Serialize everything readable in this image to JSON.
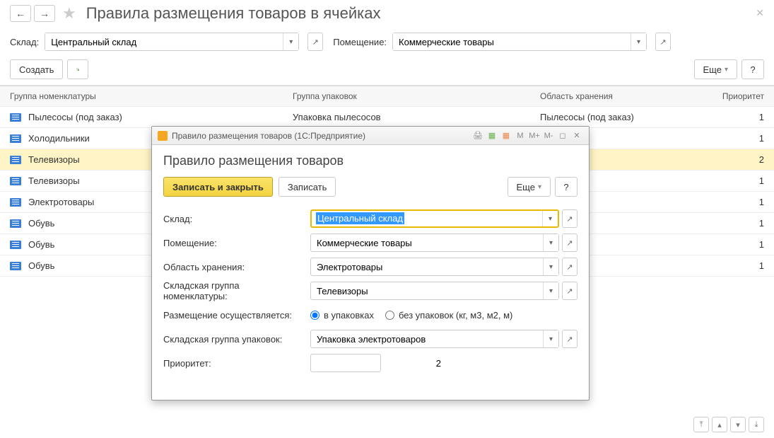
{
  "nav": {
    "back": "←",
    "forward": "→"
  },
  "page_title": "Правила размещения товаров в ячейках",
  "filters": {
    "warehouse_label": "Склад:",
    "warehouse_value": "Центральный склад",
    "room_label": "Помещение:",
    "room_value": "Коммерческие товары"
  },
  "toolbar": {
    "create": "Создать",
    "more": "Еще",
    "help": "?"
  },
  "columns": {
    "group": "Группа номенклатуры",
    "pack": "Группа упаковок",
    "area": "Область хранения",
    "priority": "Приоритет"
  },
  "rows": [
    {
      "group": "Пылесосы (под заказ)",
      "pack": "Упаковка пылесосов",
      "area": "Пылесосы (под заказ)",
      "priority": "1"
    },
    {
      "group": "Холодильники",
      "pack": "",
      "area": "",
      "priority": "1"
    },
    {
      "group": "Телевизоры",
      "pack": "",
      "area": "",
      "priority": "2",
      "selected": true
    },
    {
      "group": "Телевизоры",
      "pack": "",
      "area": "",
      "priority": "1"
    },
    {
      "group": "Электротовары",
      "pack": "",
      "area": "",
      "priority": "1"
    },
    {
      "group": "Обувь",
      "pack": "",
      "area": "",
      "priority": "1"
    },
    {
      "group": "Обувь",
      "pack": "",
      "area": "",
      "priority": "1"
    },
    {
      "group": "Обувь",
      "pack": "",
      "area": "",
      "priority": "1"
    }
  ],
  "dialog": {
    "window_title": "Правило размещения товаров  (1С:Предприятие)",
    "heading": "Правило размещения товаров",
    "save_close": "Записать и закрыть",
    "save": "Записать",
    "more": "Еще",
    "help": "?",
    "form": {
      "warehouse_label": "Склад:",
      "warehouse_value": "Центральный склад",
      "room_label": "Помещение:",
      "room_value": "Коммерческие товары",
      "area_label": "Область хранения:",
      "area_value": "Электротовары",
      "nomgroup_label": "Складская группа номенклатуры:",
      "nomgroup_value": "Телевизоры",
      "placement_label": "Размещение осуществляется:",
      "placement_opt1": "в упаковках",
      "placement_opt2": "без упаковок (кг, м3, м2, м)",
      "packgroup_label": "Складская группа упаковок:",
      "packgroup_value": "Упаковка электротоваров",
      "priority_label": "Приоритет:",
      "priority_value": "2"
    },
    "tb_icons": {
      "m": "M",
      "mplus": "M+",
      "mminus": "M-"
    }
  }
}
